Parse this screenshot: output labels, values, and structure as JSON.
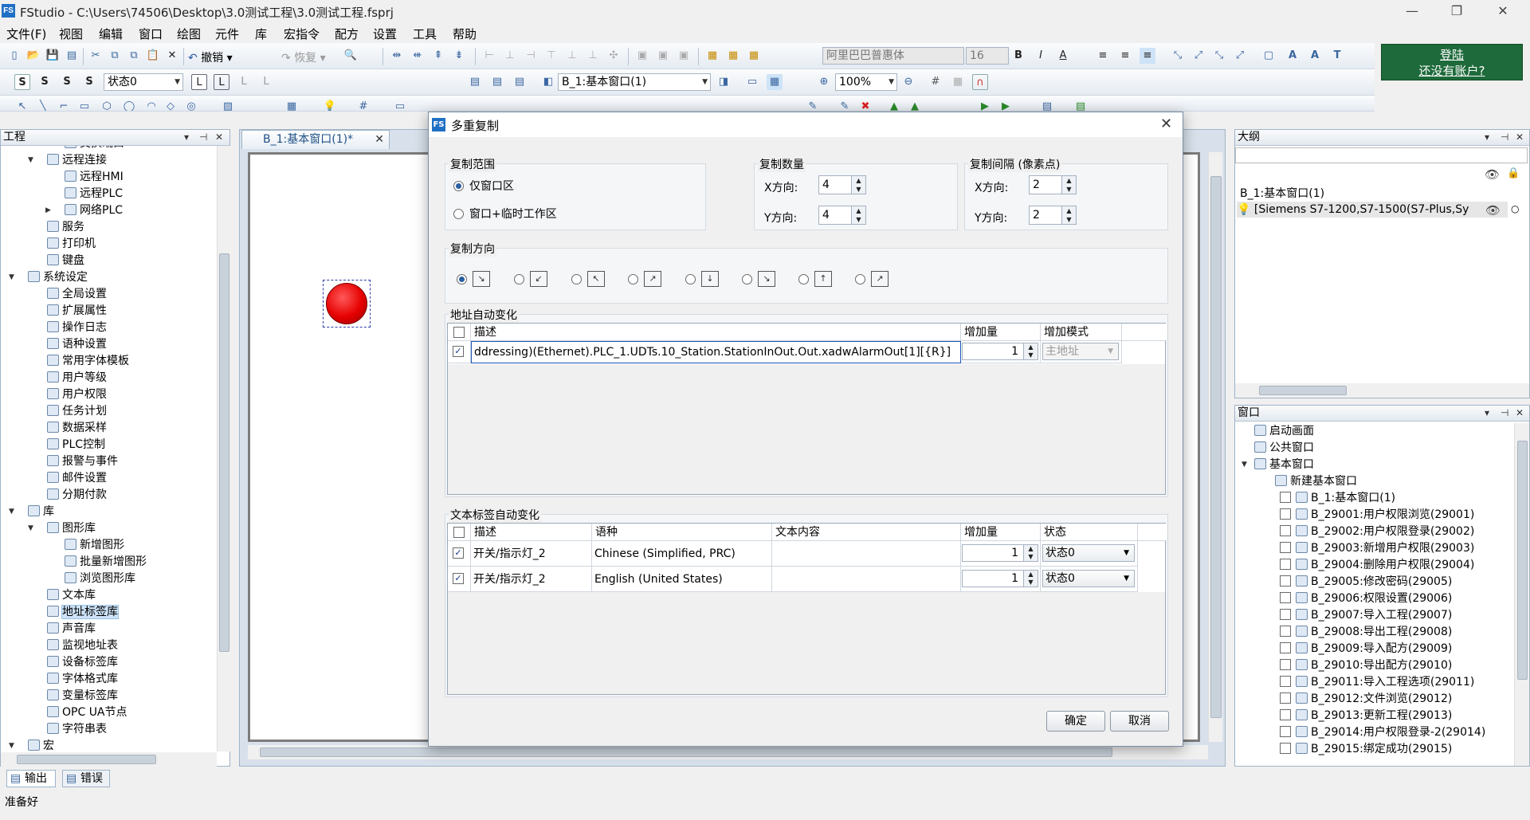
{
  "app": {
    "logo": "FS",
    "title": "FStudio - C:\\Users\\74506\\Desktop\\3.0测试工程\\3.0测试工程.fsprj"
  },
  "menu": [
    "文件(F)",
    "视图",
    "编辑",
    "窗口",
    "绘图",
    "元件",
    "库",
    "宏指令",
    "配方",
    "设置",
    "工具",
    "帮助"
  ],
  "toolbar": {
    "undo": "撤销",
    "redo": "恢复",
    "font_name": "阿里巴巴普惠体",
    "font_size": "16",
    "state": "状态0",
    "window_select": "B_1:基本窗口(1)",
    "zoom": "100%",
    "login_line1": "登陆",
    "login_line2": "还没有账户?"
  },
  "project_panel": {
    "title": "工程",
    "items": [
      {
        "label": "交换端口",
        "level": 3
      },
      {
        "label": "远程连接",
        "level": 2,
        "exp": "▼"
      },
      {
        "label": "远程HMI",
        "level": 3
      },
      {
        "label": "远程PLC",
        "level": 3
      },
      {
        "label": "网络PLC",
        "level": 3,
        "exp": "▶"
      },
      {
        "label": "服务",
        "level": 2
      },
      {
        "label": "打印机",
        "level": 2
      },
      {
        "label": "键盘",
        "level": 2
      },
      {
        "label": "系统设定",
        "level": 1,
        "exp": "▼"
      },
      {
        "label": "全局设置",
        "level": 2
      },
      {
        "label": "扩展属性",
        "level": 2
      },
      {
        "label": "操作日志",
        "level": 2
      },
      {
        "label": "语种设置",
        "level": 2
      },
      {
        "label": "常用字体模板",
        "level": 2
      },
      {
        "label": "用户等级",
        "level": 2
      },
      {
        "label": "用户权限",
        "level": 2
      },
      {
        "label": "任务计划",
        "level": 2
      },
      {
        "label": "数据采样",
        "level": 2
      },
      {
        "label": "PLC控制",
        "level": 2
      },
      {
        "label": "报警与事件",
        "level": 2
      },
      {
        "label": "邮件设置",
        "level": 2
      },
      {
        "label": "分期付款",
        "level": 2
      },
      {
        "label": "库",
        "level": 1,
        "exp": "▼"
      },
      {
        "label": "图形库",
        "level": 2,
        "exp": "▼"
      },
      {
        "label": "新增图形",
        "level": 3
      },
      {
        "label": "批量新增图形",
        "level": 3
      },
      {
        "label": "浏览图形库",
        "level": 3
      },
      {
        "label": "文本库",
        "level": 2
      },
      {
        "label": "地址标签库",
        "level": 2,
        "selected": true
      },
      {
        "label": "声音库",
        "level": 2
      },
      {
        "label": "监视地址表",
        "level": 2
      },
      {
        "label": "设备标签库",
        "level": 2
      },
      {
        "label": "字体格式库",
        "level": 2
      },
      {
        "label": "变量标签库",
        "level": 2
      },
      {
        "label": "OPC UA节点",
        "level": 2
      },
      {
        "label": "字符串表",
        "level": 2
      },
      {
        "label": "宏",
        "level": 1,
        "exp": "▼"
      }
    ]
  },
  "editor_tab": {
    "label": "B_1:基本窗口(1)*"
  },
  "dialog": {
    "title": "多重复制",
    "copy_scope": {
      "label": "复制范围",
      "opt1": "仅窗口区",
      "opt2": "窗口+临时工作区"
    },
    "copy_count": {
      "label": "复制数量",
      "x_label": "X方向:",
      "x": "4",
      "y_label": "Y方向:",
      "y": "4"
    },
    "copy_gap": {
      "label": "复制间隔 (像素点)",
      "x_label": "X方向:",
      "x": "2",
      "y_label": "Y方向:",
      "y": "2"
    },
    "copy_dir": {
      "label": "复制方向"
    },
    "addr": {
      "label": "地址自动变化",
      "headers": [
        "描述",
        "增加量",
        "增加模式"
      ],
      "rows": [
        {
          "desc": "ddressing)(Ethernet).PLC_1.UDTs.10_Station.StationInOut.Out.xadwAlarmOut[1][{R}]",
          "inc": "1",
          "mode": "主地址"
        }
      ]
    },
    "text": {
      "label": "文本标签自动变化",
      "headers": [
        "描述",
        "语种",
        "文本内容",
        "增加量",
        "状态"
      ],
      "rows": [
        {
          "desc": "开关/指示灯_2",
          "lang": "Chinese (Simplified, PRC)",
          "content": "",
          "inc": "1",
          "state": "状态0"
        },
        {
          "desc": "开关/指示灯_2",
          "lang": "English (United States)",
          "content": "",
          "inc": "1",
          "state": "状态0"
        }
      ]
    },
    "ok": "确定",
    "cancel": "取消"
  },
  "outline_panel": {
    "title": "大纲",
    "item1": "B_1:基本窗口(1)",
    "item2": "[Siemens S7-1200,S7-1500(S7-Plus,Sy"
  },
  "window_panel": {
    "title": "窗口",
    "items": [
      {
        "label": "启动画面",
        "level": 1
      },
      {
        "label": "公共窗口",
        "level": 1
      },
      {
        "label": "基本窗口",
        "level": 0,
        "exp": "▼"
      },
      {
        "label": "新建基本窗口",
        "level": 1
      },
      {
        "label": "B_1:基本窗口(1)",
        "level": 2
      },
      {
        "label": "B_29001:用户权限浏览(29001)",
        "level": 2
      },
      {
        "label": "B_29002:用户权限登录(29002)",
        "level": 2
      },
      {
        "label": "B_29003:新增用户权限(29003)",
        "level": 2
      },
      {
        "label": "B_29004:删除用户权限(29004)",
        "level": 2
      },
      {
        "label": "B_29005:修改密码(29005)",
        "level": 2
      },
      {
        "label": "B_29006:权限设置(29006)",
        "level": 2
      },
      {
        "label": "B_29007:导入工程(29007)",
        "level": 2
      },
      {
        "label": "B_29008:导出工程(29008)",
        "level": 2
      },
      {
        "label": "B_29009:导入配方(29009)",
        "level": 2
      },
      {
        "label": "B_29010:导出配方(29010)",
        "level": 2
      },
      {
        "label": "B_29011:导入工程选项(29011)",
        "level": 2
      },
      {
        "label": "B_29012:文件浏览(29012)",
        "level": 2
      },
      {
        "label": "B_29013:更新工程(29013)",
        "level": 2
      },
      {
        "label": "B_29014:用户权限登录-2(29014)",
        "level": 2
      },
      {
        "label": "B_29015:绑定成功(29015)",
        "level": 2
      }
    ]
  },
  "bottom_tabs": [
    "输出",
    "错误"
  ],
  "status": "准备好",
  "colors": {
    "accent": "#2a5fa0",
    "login_bg": "#1e6a3a",
    "lamp": "#e60000"
  }
}
